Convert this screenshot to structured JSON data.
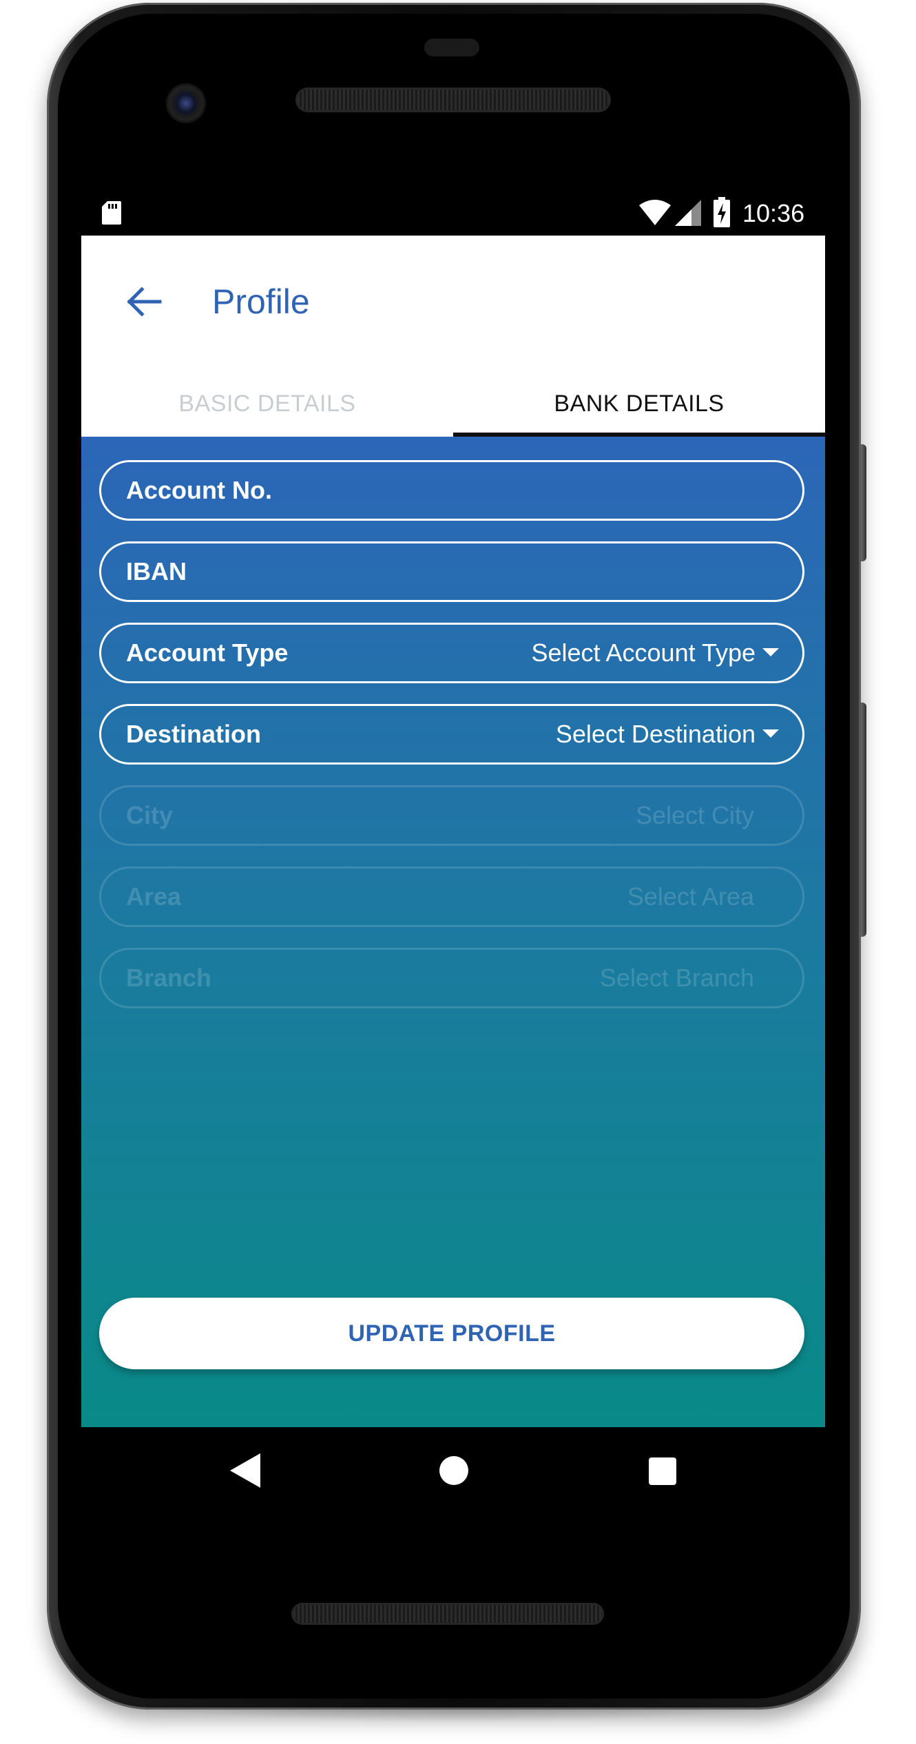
{
  "status_bar": {
    "time": "10:36",
    "icons": [
      "sd-card-icon",
      "wifi-icon",
      "signal-icon",
      "battery-charging-icon"
    ]
  },
  "app_bar": {
    "back_icon": "arrow-left-icon",
    "title": "Profile"
  },
  "tabs": [
    {
      "label": "BASIC DETAILS",
      "selected": false
    },
    {
      "label": "BANK DETAILS",
      "selected": true
    }
  ],
  "form": {
    "account_no": {
      "label": "Account No.",
      "value": ""
    },
    "iban": {
      "label": "IBAN",
      "value": ""
    },
    "account_type": {
      "label": "Account Type",
      "value": "Select Account Type"
    },
    "destination": {
      "label": "Destination",
      "value": "Select Destination"
    },
    "city": {
      "label": "City",
      "value": "Select City",
      "enabled": false
    },
    "area": {
      "label": "Area",
      "value": "Select Area",
      "enabled": false
    },
    "branch": {
      "label": "Branch",
      "value": "Select Branch",
      "enabled": false
    }
  },
  "update_button": {
    "label": "UPDATE PROFILE"
  },
  "nav_bar": {
    "icons": [
      "nav-back-icon",
      "nav-home-icon",
      "nav-recents-icon"
    ]
  },
  "colors": {
    "accent": "#2f63b3",
    "gradient_top": "#2c66b8",
    "gradient_bottom": "#098a88"
  }
}
